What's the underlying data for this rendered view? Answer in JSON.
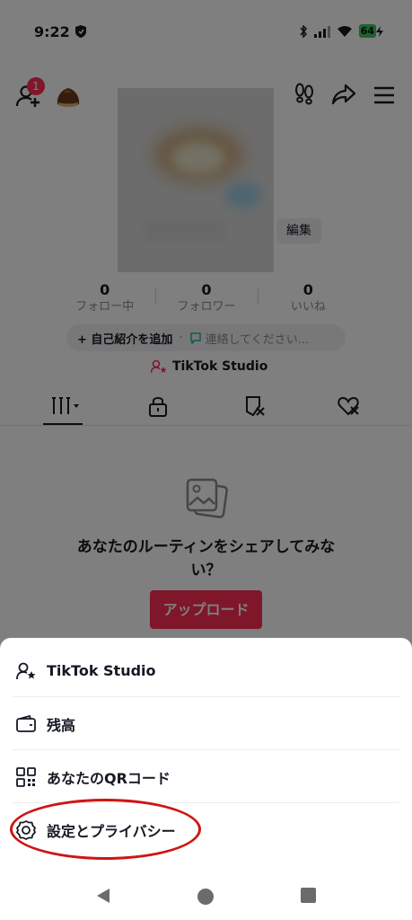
{
  "status_bar": {
    "time": "9:22",
    "battery": "64"
  },
  "header": {
    "notification_count": "1"
  },
  "profile": {
    "edit_label": "編集"
  },
  "stats": [
    {
      "value": "0",
      "label": "フォロー中"
    },
    {
      "value": "0",
      "label": "フォロワー"
    },
    {
      "value": "0",
      "label": "いいね"
    }
  ],
  "bio": {
    "add_label": "+ 自己紹介を追加",
    "separator": "·",
    "contact_label": "連絡してください..."
  },
  "studio_link": {
    "label": "TikTok Studio"
  },
  "empty_state": {
    "text": "あなたのルーティンをシェアしてみない？",
    "upload_label": "アップロード"
  },
  "sheet": {
    "items": [
      {
        "label": "TikTok Studio",
        "icon": "person-star-icon"
      },
      {
        "label": "残高",
        "icon": "wallet-icon"
      },
      {
        "label": "あなたのQRコード",
        "icon": "qr-code-icon"
      },
      {
        "label": "設定とプライバシー",
        "icon": "gear-icon"
      }
    ]
  },
  "colors": {
    "accent": "#fe2c55",
    "highlight_ring": "#d01414"
  }
}
